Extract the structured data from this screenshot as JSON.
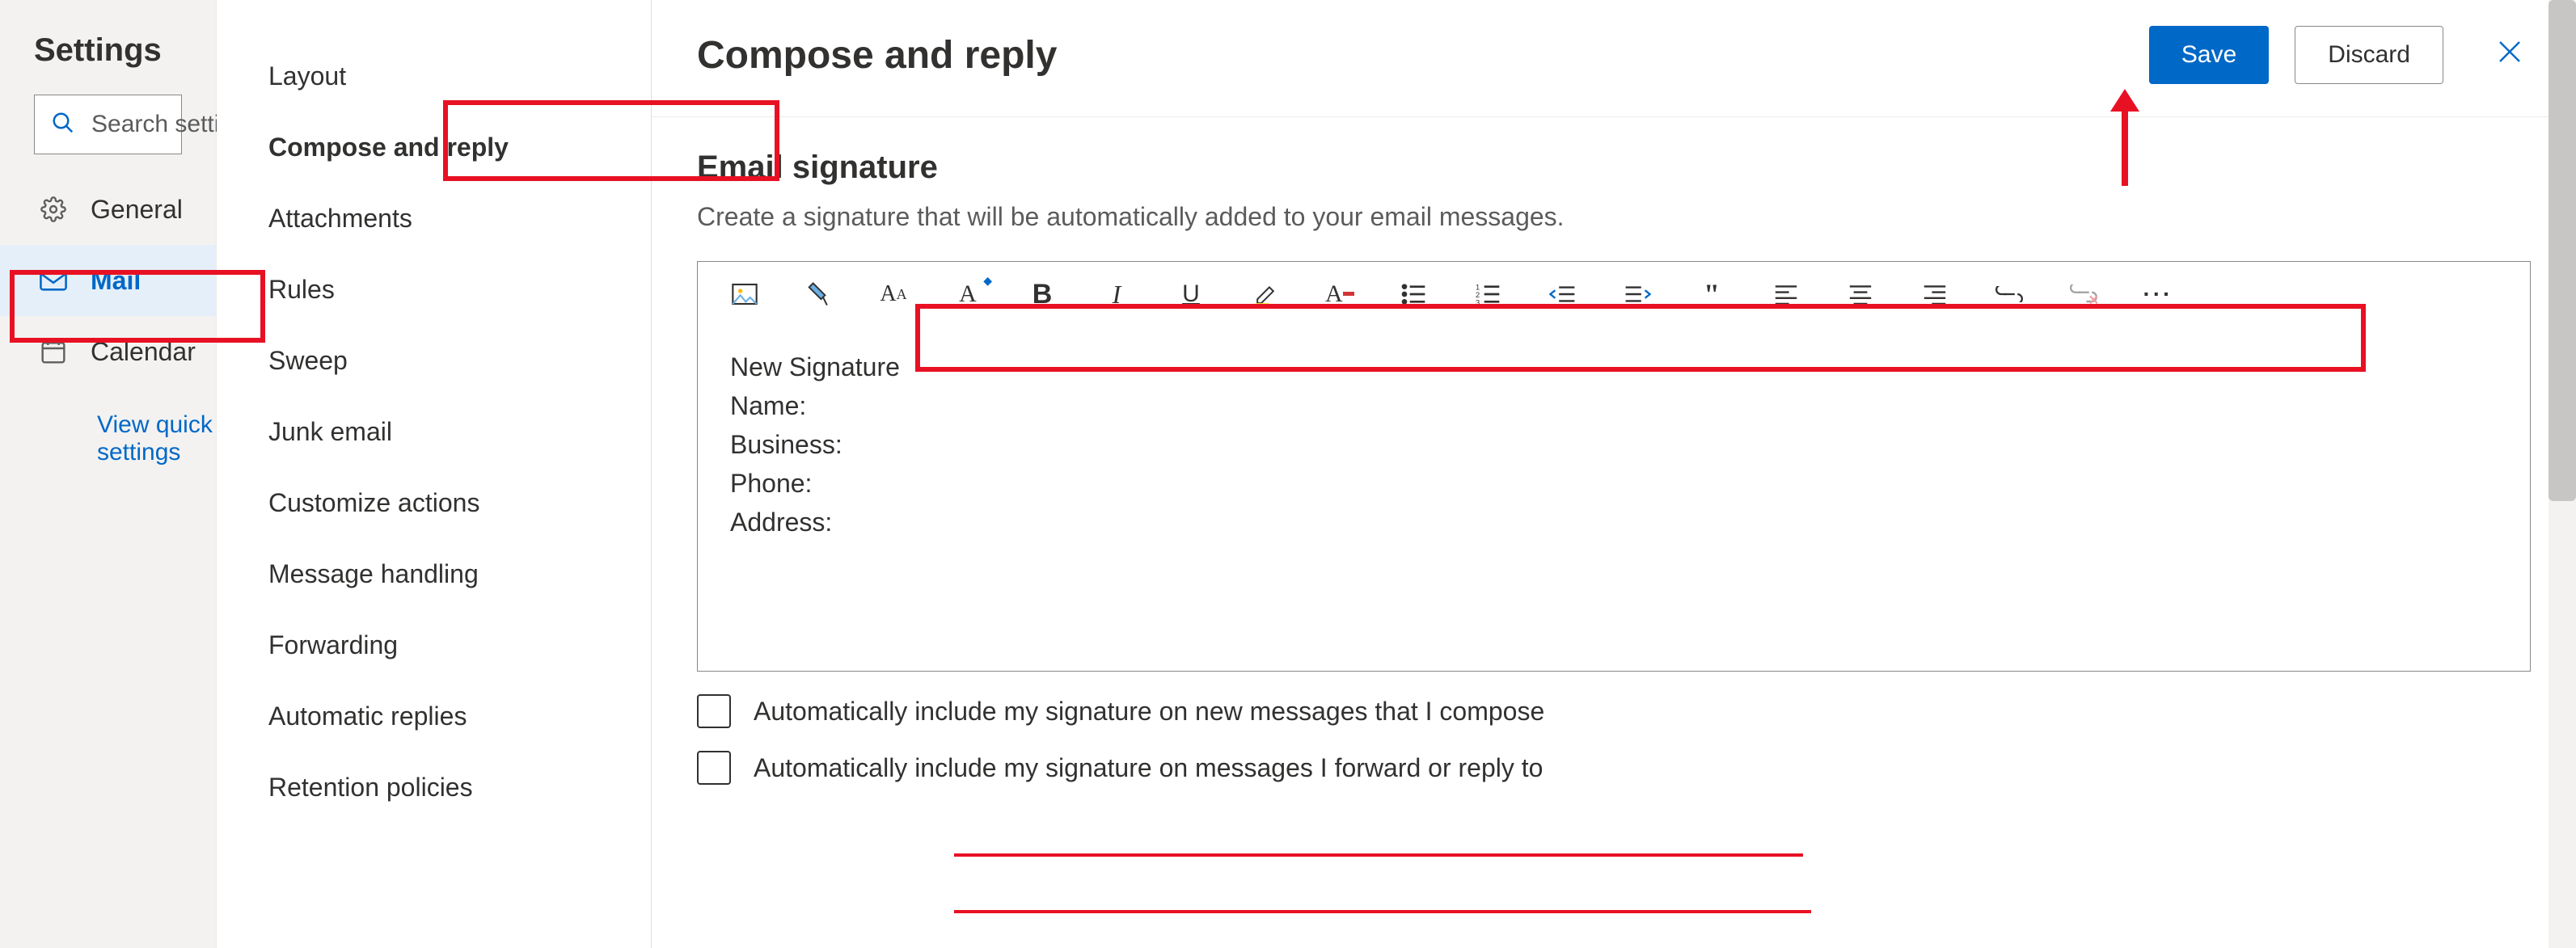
{
  "header": {
    "settings_title": "Settings",
    "search_placeholder": "Search settings"
  },
  "categories": {
    "general": "General",
    "mail": "Mail",
    "calendar": "Calendar",
    "quick_settings_link": "View quick settings"
  },
  "sub_settings": {
    "layout": "Layout",
    "compose_reply": "Compose and reply",
    "attachments": "Attachments",
    "rules": "Rules",
    "sweep": "Sweep",
    "junk": "Junk email",
    "customize": "Customize actions",
    "msg_handling": "Message handling",
    "forwarding": "Forwarding",
    "auto_replies": "Automatic replies",
    "retention": "Retention policies"
  },
  "page": {
    "title": "Compose and reply",
    "save_btn": "Save",
    "discard_btn": "Discard"
  },
  "signature": {
    "section_title": "Email signature",
    "description": "Create a signature that will be automatically added to your email messages.",
    "lines": {
      "l1": "New Signature",
      "l2": "Name:",
      "l3": "Business:",
      "l4": "Phone:",
      "l5": "Address:"
    },
    "checkbox1": "Automatically include my signature on new messages that I compose",
    "checkbox2": "Automatically include my signature on messages I forward or reply to"
  },
  "toolbar_icons": [
    "insert-image-icon",
    "format-painter-icon",
    "font-family-icon",
    "font-size-icon",
    "bold-icon",
    "italic-icon",
    "underline-icon",
    "highlight-icon",
    "font-color-icon",
    "bullet-list-icon",
    "numbered-list-icon",
    "outdent-icon",
    "indent-icon",
    "quote-icon",
    "align-left-icon",
    "align-center-icon",
    "align-right-icon",
    "insert-link-icon",
    "remove-link-icon",
    "more-options-icon"
  ],
  "colors": {
    "accent": "#0068c7",
    "annotation": "#e81123"
  }
}
